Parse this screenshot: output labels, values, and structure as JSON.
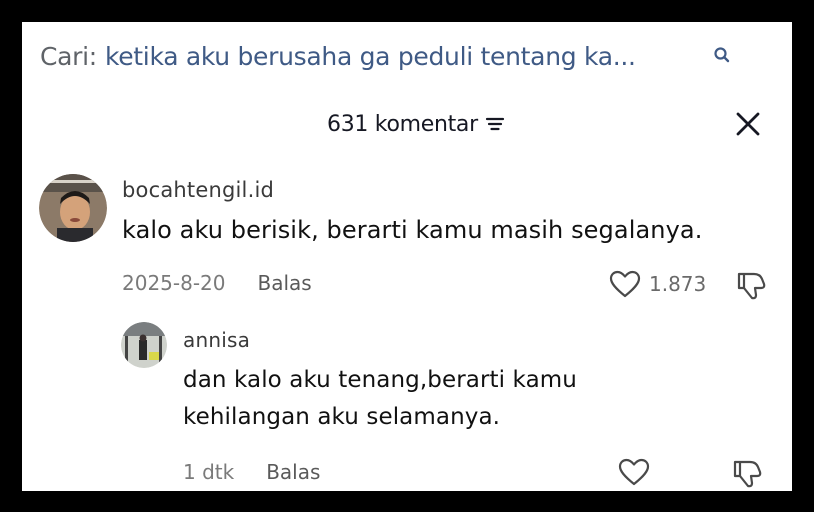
{
  "search": {
    "prefix": "Cari:",
    "query": "ketika aku berusaha ga peduli tentang ka...",
    "icon": "search-icon"
  },
  "comments_panel": {
    "count_label": "631 komentar",
    "filter_icon": "filter-icon",
    "close_icon": "close-icon"
  },
  "comments": [
    {
      "username": "bocahtengil.id",
      "text": "kalo aku berisik, berarti kamu masih segalanya.",
      "date": "2025-8-20",
      "reply_label": "Balas",
      "likes": "1.873"
    }
  ],
  "replies": [
    {
      "username": "annisa",
      "text_line1": "dan kalo aku tenang,berarti kamu",
      "text_line2": "kehilangan aku selamanya.",
      "time": "1 dtk",
      "reply_label": "Balas"
    }
  ],
  "colors": {
    "query": "#3f5a85",
    "text": "#111111",
    "muted": "#7a7a7a"
  }
}
